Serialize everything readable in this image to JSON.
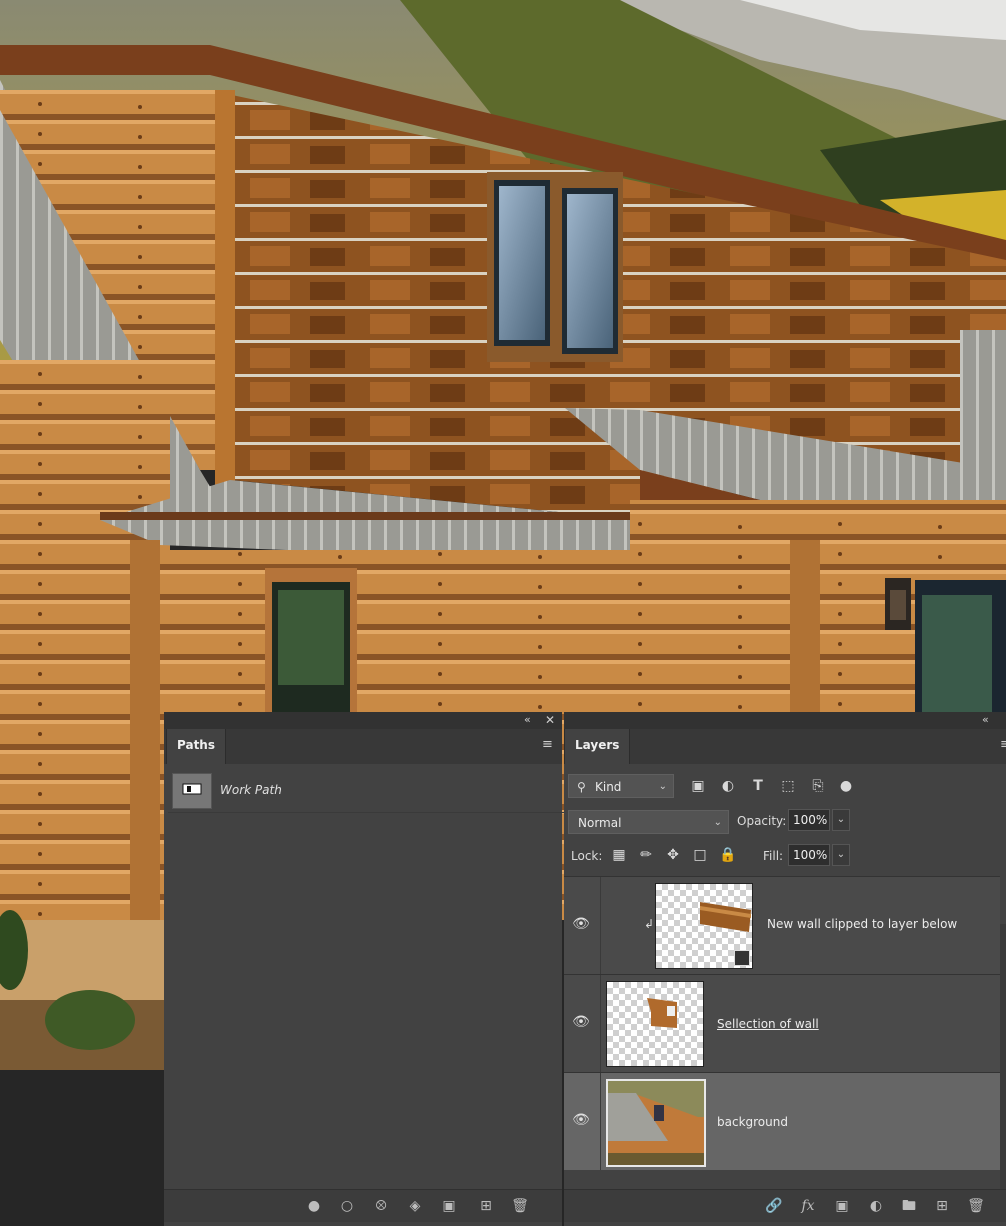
{
  "canvas": {
    "description_icon": "cabin-photo"
  },
  "paths_panel": {
    "tab_label": "Paths",
    "collapse_icon": "double-chevron-left-icon",
    "close_icon": "close-icon",
    "menu_icon": "hamburger-menu-icon",
    "items": [
      {
        "name": "Work Path"
      }
    ],
    "bottom_icons": [
      "fill-path-icon",
      "stroke-path-icon",
      "load-selection-icon",
      "make-work-path-icon",
      "add-mask-icon",
      "new-path-icon",
      "trash-icon"
    ]
  },
  "layers_panel": {
    "tab_label": "Layers",
    "collapse_icon": "double-chevron-left-icon",
    "menu_icon": "hamburger-menu-icon",
    "filter": {
      "kind_label": "Kind",
      "icons": [
        "image-filter-icon",
        "adjustment-filter-icon",
        "type-filter-icon",
        "shape-filter-icon",
        "smart-object-filter-icon",
        "toggle-filter-icon"
      ]
    },
    "blend_mode": "Normal",
    "opacity_label": "Opacity:",
    "opacity_value": "100%",
    "lock_label": "Lock:",
    "lock_icons": [
      "lock-transparent-icon",
      "lock-paint-icon",
      "lock-move-icon",
      "lock-artboard-icon",
      "lock-all-icon"
    ],
    "fill_label": "Fill:",
    "fill_value": "100%",
    "layers": [
      {
        "name": "New wall clipped to layer below",
        "clipped": true,
        "smart_object": true,
        "selected": false
      },
      {
        "name": "Sellection of wall",
        "clipped": false,
        "smart_object": false,
        "selected": false
      },
      {
        "name": "background",
        "clipped": false,
        "smart_object": false,
        "selected": true
      }
    ],
    "bottom_icons": [
      "link-icon",
      "fx-icon",
      "mask-icon",
      "adjustment-icon",
      "folder-icon",
      "new-layer-icon",
      "trash-icon"
    ]
  }
}
